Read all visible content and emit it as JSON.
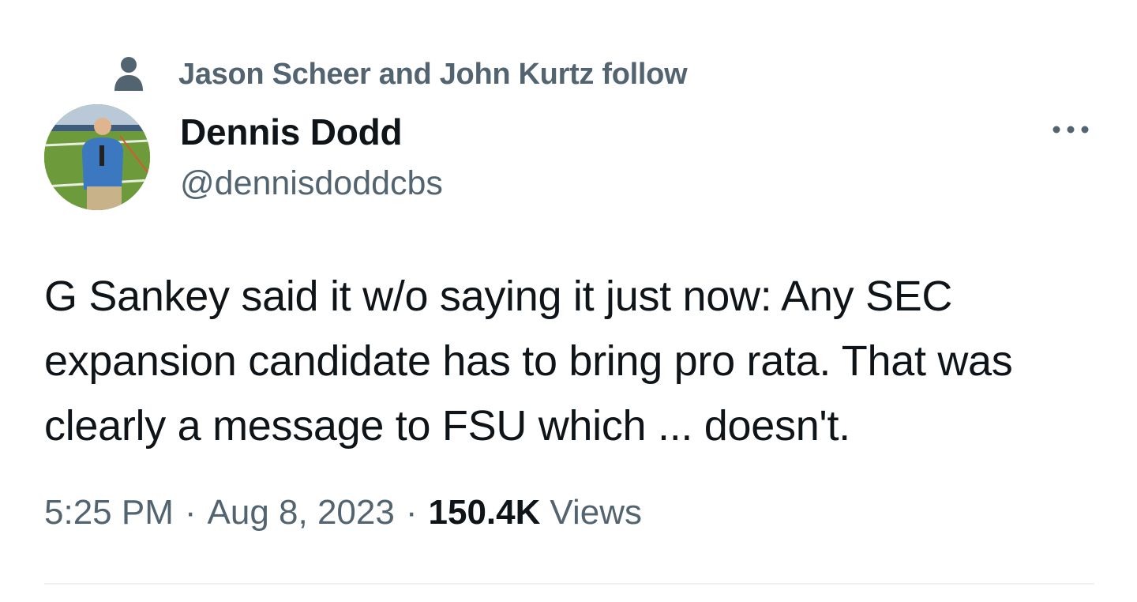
{
  "social_context": {
    "icon": "person-icon",
    "text": "Jason Scheer and John Kurtz follow"
  },
  "author": {
    "display_name": "Dennis Dodd",
    "handle": "@dennisdoddcbs",
    "avatar": "avatar-photo"
  },
  "more_button": {
    "icon": "more-horizontal-icon"
  },
  "tweet": {
    "text": "G Sankey said it w/o saying it just now: Any SEC expansion candidate has to bring pro rata. That was clearly a message to FSU which ... doesn't."
  },
  "meta": {
    "time": "5:25 PM",
    "separator": "·",
    "date": "Aug 8, 2023",
    "views_count": "150.4K",
    "views_label": "Views"
  },
  "colors": {
    "primary_text": "#0f1419",
    "secondary_text": "#536471",
    "divider": "#eff3f4"
  }
}
